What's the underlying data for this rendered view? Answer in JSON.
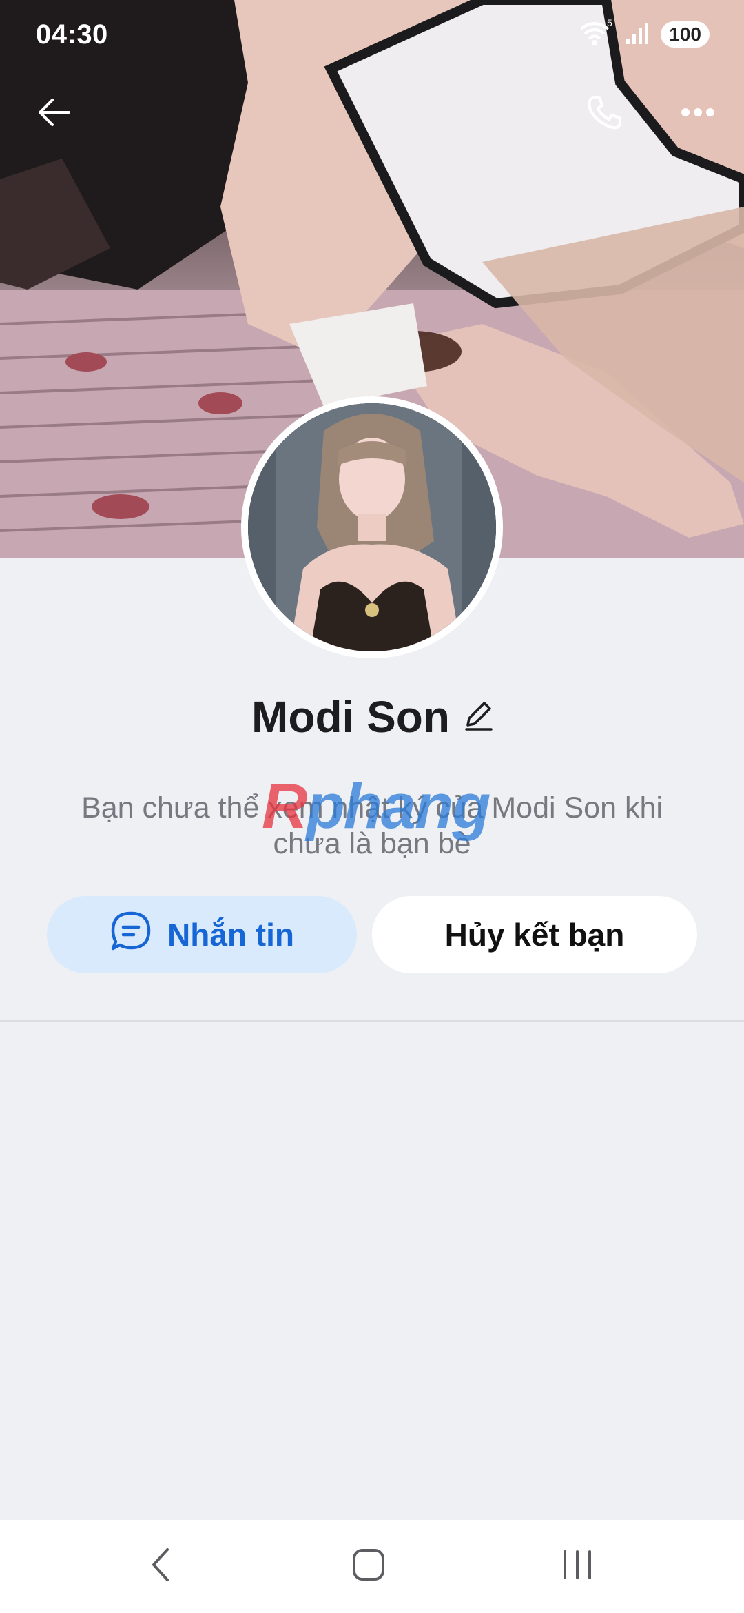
{
  "status_bar": {
    "time": "04:30",
    "wifi_badge": "5",
    "battery": "100"
  },
  "top_bar": {
    "back_icon": "arrow-left-icon",
    "call_icon": "phone-icon",
    "more_icon": "more-horizontal-icon"
  },
  "profile": {
    "name": "Modi Son",
    "edit_icon": "pencil-icon",
    "notice": "Bạn chưa thể xem nhật ký của Modi Son khi chưa là bạn bè"
  },
  "actions": {
    "message_label": "Nhắn tin",
    "message_icon": "chat-bubble-icon",
    "unfriend_label": "Hủy kết bạn"
  },
  "watermark": {
    "r": "R",
    "rest": "phang"
  },
  "nav_bar": {
    "back": "chevron-left-icon",
    "home": "home-square-icon",
    "recents": "recents-lines-icon"
  },
  "colors": {
    "accent": "#1766d6",
    "message_bg": "#d9eafc",
    "page_bg": "#eff0f4"
  }
}
